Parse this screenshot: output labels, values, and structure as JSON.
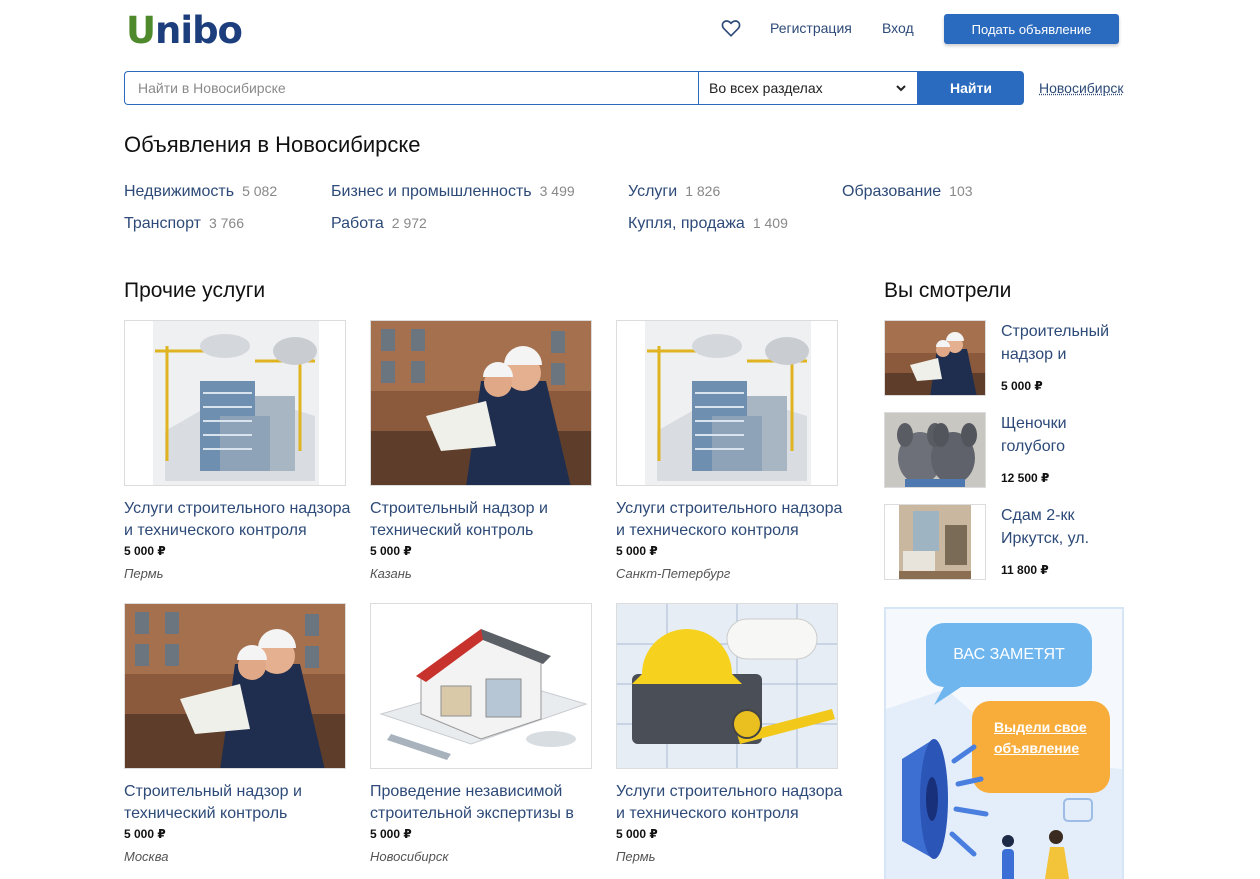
{
  "header": {
    "logo_first": "U",
    "logo_rest": "nibo",
    "register": "Регистрация",
    "login": "Вход",
    "post_ad": "Подать объявление"
  },
  "search": {
    "placeholder": "Найти в Новосибирске",
    "section": "Во всех разделах",
    "button": "Найти",
    "city": "Новосибирск"
  },
  "page_title": "Объявления в Новосибирске",
  "categories": [
    {
      "label": "Недвижимость",
      "count": "5 082"
    },
    {
      "label": "Транспорт",
      "count": "3 766"
    },
    {
      "label": "Бизнес и промышленность",
      "count": "3 499"
    },
    {
      "label": "Работа",
      "count": "2 972"
    },
    {
      "label": "Услуги",
      "count": "1 826"
    },
    {
      "label": "Купля, продажа",
      "count": "1 409"
    },
    {
      "label": "Образование",
      "count": "103"
    }
  ],
  "other_services": {
    "title": "Прочие услуги",
    "cards": [
      {
        "title": "Услуги строительного надзора и технического контроля",
        "price": "5 000 ₽",
        "city": "Пермь",
        "image": "construction-model"
      },
      {
        "title": "Строительный надзор и технический контроль",
        "price": "5 000 ₽",
        "city": "Казань",
        "image": "engineers"
      },
      {
        "title": "Услуги строительного надзора и технического контроля",
        "price": "5 000 ₽",
        "city": "Санкт-Петербург",
        "image": "construction-model"
      },
      {
        "title": "Строительный надзор и технический контроль",
        "price": "5 000 ₽",
        "city": "Москва",
        "image": "engineers"
      },
      {
        "title": "Проведение независимой строительной экспертизы в",
        "price": "5 000 ₽",
        "city": "Новосибирск",
        "image": "house-cutaway"
      },
      {
        "title": "Услуги строительного надзора и технического контроля",
        "price": "5 000 ₽",
        "city": "Пермь",
        "image": "helmet-tools"
      }
    ]
  },
  "viewed": {
    "title": "Вы смотрели",
    "items": [
      {
        "title": "Строительный надзор и",
        "price": "5 000 ₽",
        "image": "engineers"
      },
      {
        "title": "Щеночки голубого",
        "price": "12 500 ₽",
        "image": "puppies"
      },
      {
        "title": "Сдам 2-кк Иркутск, ул.",
        "price": "11 800 ₽",
        "image": "apartment"
      }
    ]
  },
  "banner": {
    "bubble1": "ВАС ЗАМЕТЯТ",
    "bubble2": "Выдели свое объявление"
  },
  "colors": {
    "brand_blue": "#2b6bbf",
    "link": "#2d4a78",
    "logo_green": "#4e8a2c",
    "logo_navy": "#1d3e7d",
    "banner_orange": "#f8ac3a",
    "banner_blue": "#6fb6ef"
  }
}
